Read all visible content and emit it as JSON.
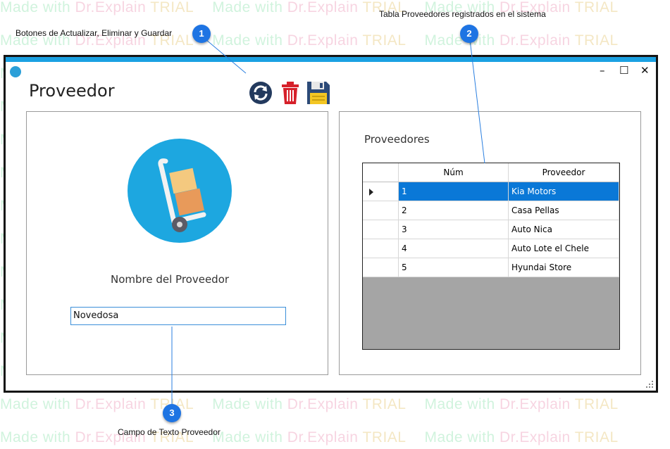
{
  "watermark": {
    "made_with": "Made with ",
    "brand": "Dr.Explain",
    "trial": " TRIAL"
  },
  "annotations": {
    "note1": "Botones de Actualizar, Eliminar y Guardar",
    "note2": "Tabla Proveedores registrados en el sistema",
    "note3": "Campo de Texto Proveedor",
    "markers": [
      "1",
      "2",
      "3"
    ]
  },
  "window": {
    "title": "Proveedor",
    "controls": {
      "minimize": "–",
      "maximize": "☐",
      "close": "✕"
    },
    "toolbar": {
      "refresh": "refresh-icon",
      "delete": "trash-icon",
      "save": "floppy-disk-icon"
    }
  },
  "left_panel": {
    "image": "hand-truck-boxes-icon",
    "label": "Nombre del Proveedor",
    "input_value": "Novedosa"
  },
  "right_panel": {
    "label": "Proveedores",
    "columns": [
      "Núm",
      "Proveedor"
    ],
    "rows": [
      {
        "num": "1",
        "name": "Kia Motors"
      },
      {
        "num": "2",
        "name": "Casa Pellas"
      },
      {
        "num": "3",
        "name": "Auto Nica"
      },
      {
        "num": "4",
        "name": "Auto Lote el Chele"
      },
      {
        "num": "5",
        "name": "Hyundai Store"
      }
    ]
  },
  "colors": {
    "accent": "#1ba1e2",
    "selection": "#0a78d7",
    "marker": "#1e74e3"
  }
}
